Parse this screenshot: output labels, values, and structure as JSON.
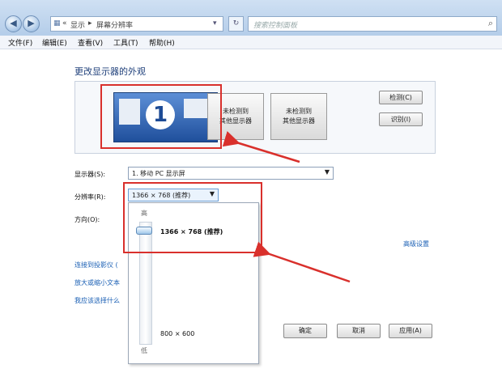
{
  "window": {
    "breadcrumb": [
      "«",
      "显示",
      "▸",
      "屏幕分辨率"
    ],
    "search_placeholder": "搜索控制面板"
  },
  "menu": [
    "文件(F)",
    "编辑(E)",
    "查看(V)",
    "工具(T)",
    "帮助(H)"
  ],
  "page_title": "更改显示器的外观",
  "monitors": {
    "primary_number": "1",
    "undetected_1": [
      "未检测到",
      "其他显示器"
    ],
    "undetected_2": [
      "未检测到",
      "其他显示器"
    ]
  },
  "buttons": {
    "detect": "检测(C)",
    "identify": "识别(I)",
    "ok": "确定",
    "cancel": "取消",
    "apply": "应用(A)"
  },
  "fields": {
    "display_label": "显示器(S):",
    "display_value": "1. 移动 PC 显示屏",
    "resolution_label": "分辨率(R):",
    "resolution_value": "1366 × 768 (推荐)",
    "orientation_label": "方向(O):"
  },
  "resolution_dropdown": {
    "high": "高",
    "low": "低",
    "top_option": "1366 × 768 (推荐)",
    "bottom_option": "800 × 600",
    "slider_position": 1.0
  },
  "links": {
    "advanced": "高级设置",
    "projector": "连接到投影仪 (",
    "text_size": "放大或缩小文本",
    "which_settings": "我应该选择什么"
  }
}
